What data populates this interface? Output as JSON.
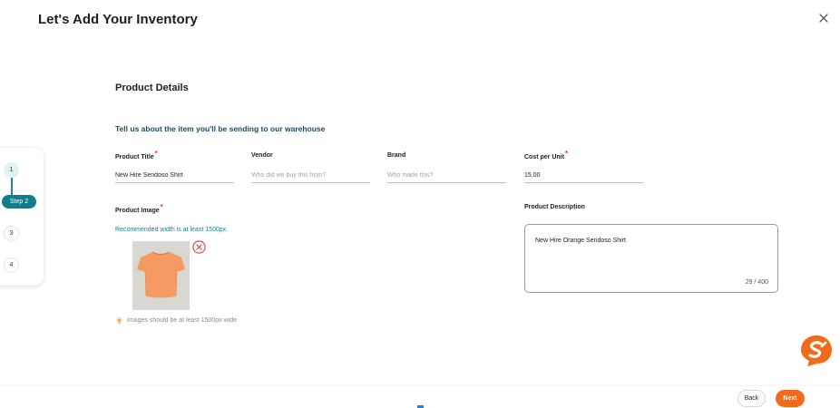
{
  "header": {
    "title": "Let's Add Your Inventory",
    "close_icon": "close-icon"
  },
  "stepper": {
    "steps": [
      {
        "label": "1",
        "state": "completed"
      },
      {
        "label": "Step 2",
        "state": "active"
      },
      {
        "label": "3",
        "state": "upcoming"
      },
      {
        "label": "4",
        "state": "upcoming"
      }
    ]
  },
  "section": {
    "title": "Product Details",
    "subtitle": "Tell us about the item you'll be sending to our warehouse"
  },
  "form": {
    "product_title": {
      "label": "Product Title",
      "required": "*",
      "value": "New Hire Sendoso Shirt",
      "placeholder": ""
    },
    "vendor": {
      "label": "Vendor",
      "value": "",
      "placeholder": "Who did we buy this from?"
    },
    "brand": {
      "label": "Brand",
      "value": "",
      "placeholder": "Who made this?"
    },
    "cost_per_unit": {
      "label": "Cost per Unit",
      "required": "*",
      "value": "15.00",
      "placeholder": ""
    },
    "product_image": {
      "label": "Product Image",
      "required": "*",
      "hint": "Recommended width is at least 1500px.",
      "note": "Images should be at least 1500px wide",
      "note_icon": "lightbulb-icon",
      "remove_icon": "remove-circle-icon"
    },
    "product_description": {
      "label": "Product Description",
      "value": "New Hire Orange Sendoso Shirt",
      "counter": "29 / 400"
    }
  },
  "footer": {
    "back_label": "Back",
    "next_label": "Next"
  },
  "colors": {
    "accent_teal": "#0f7e8c",
    "accent_orange": "#f26a1b",
    "required_red": "#e53935"
  }
}
